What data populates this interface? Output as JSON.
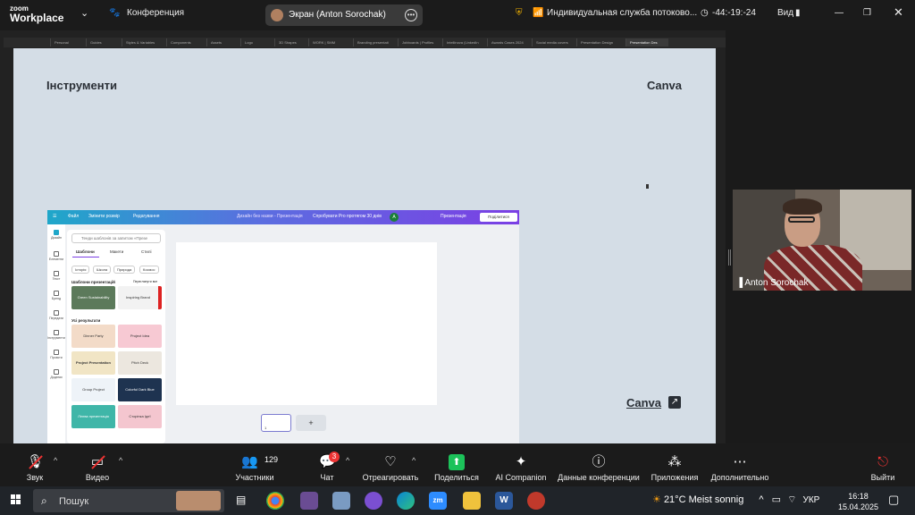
{
  "zoom_top": {
    "logo_line1": "zoom",
    "logo_line2": "Workplace",
    "meeting_label": "Конференция",
    "share_pill_text": "Экран (Anton Sorochak)",
    "security_text": "Индивидуальная служба потоково...",
    "timer": "-44:-19:-24",
    "view_label": "Вид"
  },
  "browser_tabs": [
    "Personal",
    "Guides",
    "Styles & Variables",
    "Components",
    "Assets",
    "Logo",
    "3D Shapes",
    "WORK | SMM",
    "Branding presentati",
    "Jobboards | Profiles",
    "Intellinova (LinkedIn",
    "Awards Cases 2024",
    "Social media covers",
    "Presentation Design",
    "Presentation Des"
  ],
  "slide": {
    "title": "Інструменти",
    "brand": "Canva",
    "link_label": "Canva",
    "link_arrow": "↗"
  },
  "canva": {
    "top_items": [
      "Файл",
      "Змінити розмір",
      "Редагування",
      "Дизайн без назви - Презентація",
      "Спробувати Pro протягом 30 днів"
    ],
    "avatar_letter": "A",
    "present_label": "Презентація",
    "share_label": "Поділитися",
    "rail": [
      "Дизайн",
      "Елементи",
      "Текст",
      "Бренд",
      "Передати",
      "Інструменти",
      "Проєкти",
      "Додатки"
    ],
    "search_placeholder": "Тенди шаблонів за запитом «Презе",
    "tabs": [
      "Шаблони",
      "Макети",
      "Стилі"
    ],
    "chips": [
      "Історія",
      "Школа",
      "Природа",
      "Космос"
    ],
    "section1": "Шаблони презентацій",
    "section1_link": "Переглянути все",
    "section2": "Усі результати",
    "thumbs": [
      "Green Sustainability",
      "Inspiring Brand",
      "Dinner Party",
      "Project Idea",
      "Project Presentation",
      "Pitch Deck",
      "Group Project",
      "Colorful Dark Blue",
      "Лінгва презентація",
      "Сторінка Ідеї"
    ],
    "page_number": "1",
    "add_page": "+"
  },
  "participant": {
    "name": "Anton Sorochak"
  },
  "toolbar": {
    "audio": "Звук",
    "video": "Видео",
    "participants": "Участники",
    "participants_count": "129",
    "chat": "Чат",
    "chat_badge": "3",
    "react": "Отреагировать",
    "share": "Поделиться",
    "ai": "AI Companion",
    "info": "Данные конференции",
    "apps": "Приложения",
    "more": "Дополнительно",
    "leave": "Выйти"
  },
  "taskbar": {
    "search": "Пошук",
    "weather": "21°C  Meist sonnig",
    "lang": "УКР",
    "time": "16:18",
    "date": "15.04.2025"
  }
}
